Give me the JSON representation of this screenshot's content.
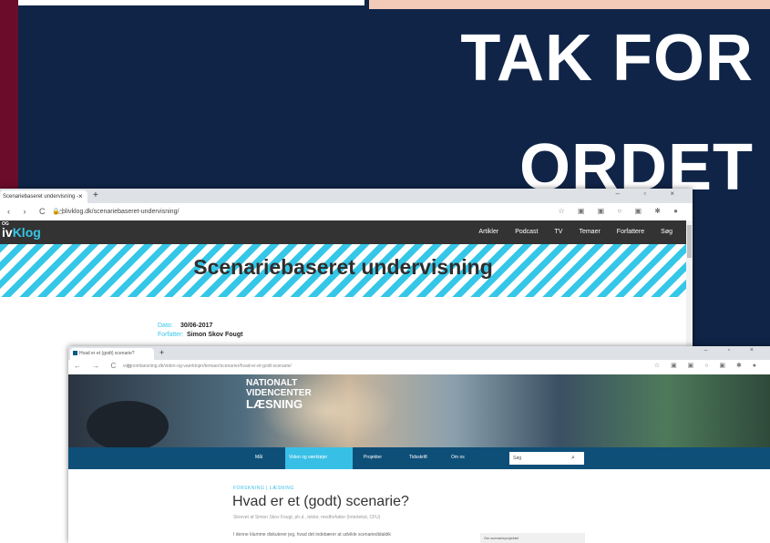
{
  "slide": {
    "title_line1": "TAK FOR",
    "title_line2": "ORDET",
    "colors": {
      "navy": "#0f2447",
      "maroon": "#6b0d2a",
      "peach": "#f3c9b8",
      "pink": "#d9a6c6"
    }
  },
  "window1": {
    "tab_title": "Scenariebaseret undervisning - ",
    "tab_close": "×",
    "new_tab": "+",
    "window_controls": "– ▫ ×",
    "nav_icons": "‹ › C ⌂",
    "lock_icon": "lock-icon",
    "url": "blivklog.dk/scenariebaseret-undervisning/",
    "extension_icons": "☆ ▣ ▣ ○ ▣ ✱ ●",
    "logo_prefix": "OG",
    "logo_main": "iv",
    "logo_accent": "Klog",
    "menu": [
      "Artikler",
      "Podcast",
      "TV",
      "Temaer",
      "Forfattere",
      "Søg"
    ],
    "article_title": "Scenariebaseret undervisning",
    "date_label": "Dato:",
    "date": "30/06-2017",
    "author_label": "Forfatter:",
    "author": "Simon Skov Fougt",
    "accent_color": "#35c7e8"
  },
  "window2": {
    "tab_title": "Hvad er et (godt) scenarie?",
    "new_tab": "+",
    "window_controls": "– ▫ ×",
    "nav_icons": "← → C ⌂",
    "url": "videnomlaesning.dk/viden-og-vaerktojer/temaer/scenarier/hvad-er-et-godt-scenarie/",
    "extension_icons": "☆ ▣ ▣ ○ ▣ ✱ ●",
    "brand_line1": "NATIONALT",
    "brand_line2": "VIDENCENTER",
    "brand_line3": "LÆSNING",
    "nav_items": [
      "Mål",
      "Viden og værktøjer",
      "Projekter",
      "Tidsskrift",
      "Om os"
    ],
    "search_placeholder": "Søg",
    "search_icon": "search-icon",
    "kicker": "FORSKNING | LÆSNING",
    "heading": "Hvad er et (godt) scenarie?",
    "byline": "Skrevet af Simon Skov Fougt, ph.d., lektor, medforfatter (Intertekst, CFU)",
    "lead": "I denne klumme diskuterer jeg, hvad det indebærer at udvikle scenariedidaktik",
    "side_box_label": "Om scenarieprojektet",
    "nav_color": "#0e4f78",
    "active_color": "#38bfe6"
  }
}
